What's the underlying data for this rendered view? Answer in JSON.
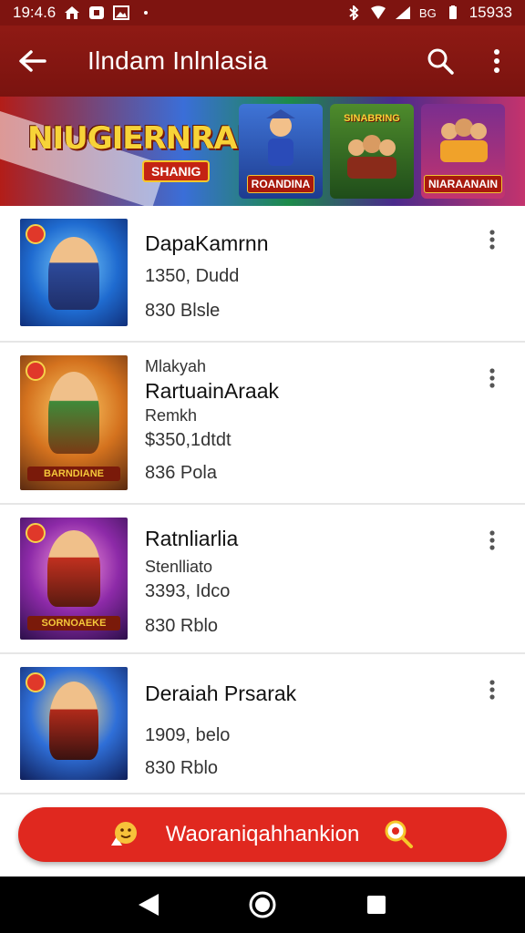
{
  "status_bar": {
    "time_left": "19:4.6",
    "time_right": "15933",
    "signal_text": "BG"
  },
  "app_bar": {
    "title": "Ilndam Inlnlasia",
    "back_icon": "arrow-left-icon",
    "search_icon": "search-icon",
    "more_icon": "more-vert-icon"
  },
  "banner": {
    "title": "NIUGIERNRAIIN",
    "tag": "SHANIG",
    "promos": [
      "ROANDINA",
      "SINABRING",
      "NIARAANAIN"
    ]
  },
  "items": [
    {
      "title": "DapaKamrnn",
      "lines": [
        "1350, Dudd",
        "830 Blsle"
      ]
    },
    {
      "pre": "Mlakyah",
      "title": "RartuainAraak",
      "lines": [
        "Remkh",
        "$350,1dtdt",
        "836 Pola"
      ],
      "thumb_caption": "BARNDIANE"
    },
    {
      "title": "Ratnliarlia",
      "lines": [
        "Stenlliato",
        "3393, Idco",
        "830 Rblo"
      ],
      "thumb_caption": "SORNOAEKE"
    },
    {
      "title": "Deraiah Prsarak",
      "lines": [
        "1909, belo",
        "830 Rblo"
      ]
    }
  ],
  "cta": {
    "label": "Waoraniqahhankion"
  },
  "colors": {
    "app_bar": "#7a130f",
    "cta": "#e0281f",
    "nav_bar": "#000000"
  }
}
